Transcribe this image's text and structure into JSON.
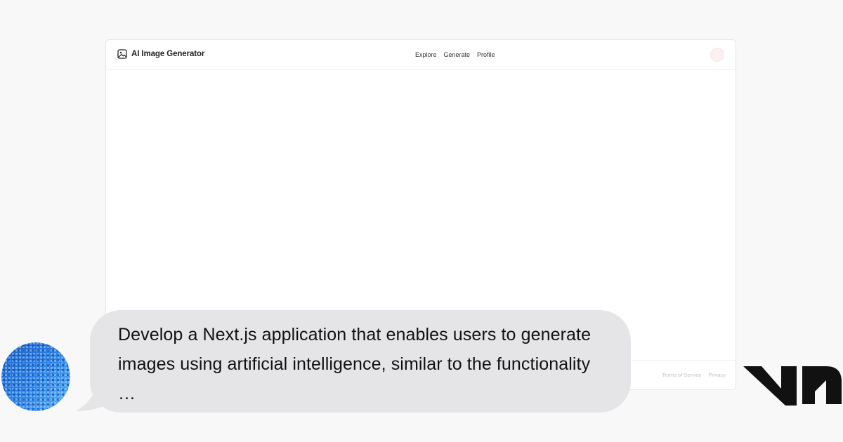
{
  "app": {
    "title": "AI Image Generator",
    "icon": "image-icon",
    "nav": [
      "Explore",
      "Generate",
      "Profile"
    ],
    "footer_links": [
      "Terms of Service",
      "Privacy"
    ]
  },
  "prompt": {
    "text": "Develop a Next.js application that enables users to generate images using artificial intelligence, similar to the functionality …"
  },
  "branding": {
    "logo": "v0-logo"
  },
  "colors": {
    "page_background": "#f8f8f8",
    "bubble_background": "#e5e5e7",
    "avatar_blue": "#1f6fd6",
    "logo": "#111111"
  }
}
